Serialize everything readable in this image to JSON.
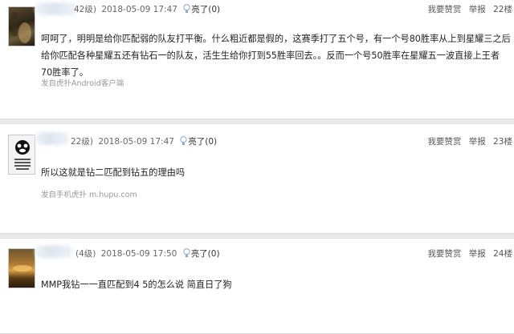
{
  "posts": [
    {
      "level": "42级)",
      "time": "2018-05-09 17:47",
      "light_label": "亮了(0)",
      "actions": {
        "like": "我要赞赏",
        "report": "举报",
        "floor": "22楼"
      },
      "content": "呵呵了，明明是给你匹配弱的队友打平衡。什么粗近都是假的，这赛季打了五个号，有一个号80胜率从上到星耀三之后给你匹配各种星耀五还有钻石一的队友，活生生给你打到55胜率回去。。反而一个号50胜率在星耀五一波直接上王者70胜率了。",
      "source": "发自虎扑Android客户端"
    },
    {
      "level": "22级)",
      "time": "2018-05-09 17:47",
      "light_label": "亮了(0)",
      "actions": {
        "like": "我要赞赏",
        "report": "举报",
        "floor": "23楼"
      },
      "content": "所以这就是钻二匹配到钻五的理由吗",
      "source": "发自手机虎扑 m.hupu.com"
    },
    {
      "level": "(4级)",
      "time": "2018-05-09 17:50",
      "light_label": "亮了(0)",
      "actions": {
        "like": "我要赞赏",
        "report": "举报",
        "floor": "24楼"
      },
      "content": "MMP我钻一一直匹配到4 5的怎么说 简直日了狗",
      "source": ""
    }
  ],
  "colors": {
    "background": "#e9e9e9",
    "card": "#ffffff",
    "meta_text": "#666666",
    "source_text": "#999999"
  }
}
